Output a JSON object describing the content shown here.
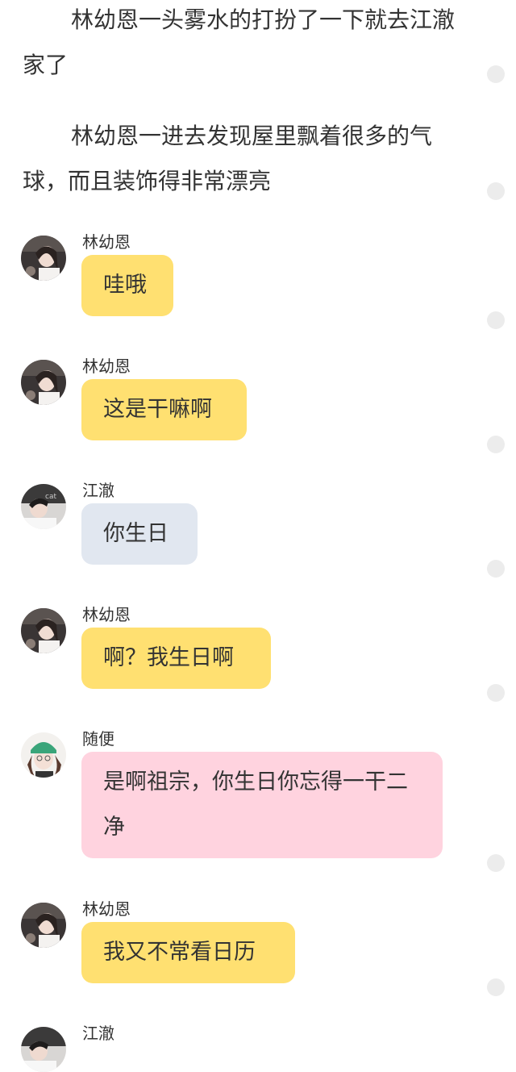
{
  "narration": [
    "林幼恩一头雾水的打扮了一下就去江澈家了",
    "林幼恩一进去发现屋里飘着很多的气球，而且装饰得非常漂亮"
  ],
  "messages": [
    {
      "sender": "林幼恩",
      "text": "哇哦",
      "bubble_color": "#ffe071",
      "avatar": "linyouen-avatar"
    },
    {
      "sender": "林幼恩",
      "text": "这是干嘛啊",
      "bubble_color": "#ffe071",
      "avatar": "linyouen-avatar"
    },
    {
      "sender": "江澈",
      "text": "你生日",
      "bubble_color": "#e1e7f0",
      "avatar": "jiangche-avatar"
    },
    {
      "sender": "林幼恩",
      "text": "啊？我生日啊",
      "bubble_color": "#ffe071",
      "avatar": "linyouen-avatar"
    },
    {
      "sender": "随便",
      "text": "是啊祖宗，你生日你忘得一干二净",
      "bubble_color": "#ffd3df",
      "avatar": "suibian-avatar"
    },
    {
      "sender": "林幼恩",
      "text": "我又不常看日历",
      "bubble_color": "#ffe071",
      "avatar": "linyouen-avatar"
    },
    {
      "sender": "江澈",
      "text": "",
      "bubble_color": "#e1e7f0",
      "avatar": "jiangche-avatar"
    }
  ]
}
